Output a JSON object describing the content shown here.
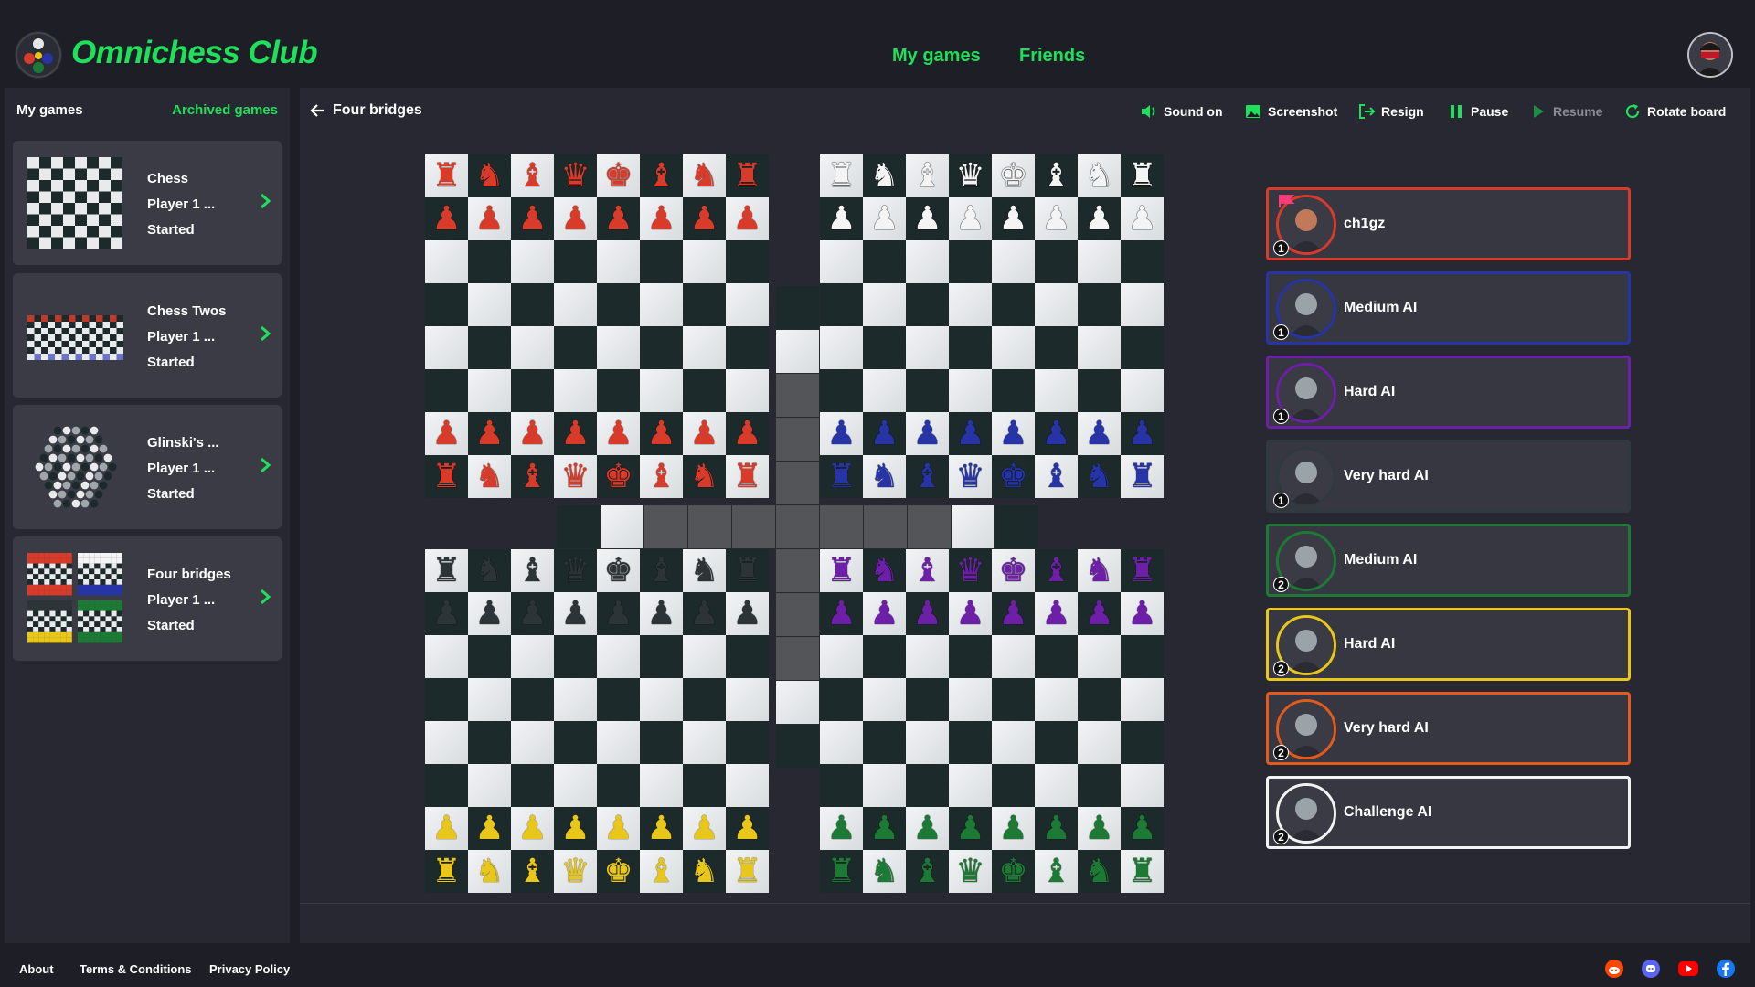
{
  "header": {
    "logo_text": "Omnichess Club",
    "nav": [
      "My games",
      "Friends"
    ]
  },
  "sidebar": {
    "title": "My games",
    "archived_link": "Archived games",
    "games": [
      {
        "name": "Chess",
        "player": "Player 1 ...",
        "status": "Started"
      },
      {
        "name": "Chess Twos",
        "player": "Player 1 ...",
        "status": "Started"
      },
      {
        "name": "Glinski's ...",
        "player": "Player 1 ...",
        "status": "Started"
      },
      {
        "name": "Four bridges",
        "player": "Player 1 ...",
        "status": "Started"
      }
    ]
  },
  "toolbar": {
    "game_title": "Four bridges",
    "sound": "Sound on",
    "screenshot": "Screenshot",
    "resign": "Resign",
    "pause": "Pause",
    "resume": "Resume",
    "rotate": "Rotate board"
  },
  "colors": {
    "accent": "#1ee05a",
    "red": "#d93b2b",
    "blue": "#2634a8",
    "purple": "#6d1fa8",
    "yellow": "#e8c71a",
    "green": "#1d7a35",
    "black": "#2d3437",
    "white": "#f4f4f4"
  },
  "board": {
    "armies": [
      {
        "color": "red",
        "back_rank": "rnbqkbnr"
      },
      {
        "color": "white",
        "back_rank": "rnbqkbnr"
      },
      {
        "color": "red",
        "back_rank": "rnbqkbnr"
      },
      {
        "color": "blue",
        "back_rank": "rnbqkbnr"
      },
      {
        "color": "black",
        "back_rank": "rnbqkbnr"
      },
      {
        "color": "purple",
        "back_rank": "rnbqkbnr"
      },
      {
        "color": "yellow",
        "back_rank": "rnbqkbnr"
      },
      {
        "color": "green",
        "back_rank": "rnbqkbnr"
      }
    ]
  },
  "players": [
    {
      "name": "ch1gz",
      "team": "1",
      "border": "#d93b2b",
      "flag": true
    },
    {
      "name": "Medium AI",
      "team": "1",
      "border": "#2634a8"
    },
    {
      "name": "Hard AI",
      "team": "1",
      "border": "#6d1fa8"
    },
    {
      "name": "Very hard AI",
      "team": "1",
      "border": "#2f3a3e"
    },
    {
      "name": "Medium AI",
      "team": "2",
      "border": "#1d7a35"
    },
    {
      "name": "Hard AI",
      "team": "2",
      "border": "#e8c71a"
    },
    {
      "name": "Very hard AI",
      "team": "2",
      "border": "#e35a1c"
    },
    {
      "name": "Challenge AI",
      "team": "2",
      "border": "#f2f2f2"
    }
  ],
  "footer": {
    "links": [
      "About",
      "Terms & Conditions",
      "Privacy Policy"
    ],
    "social": [
      "reddit-icon",
      "discord-icon",
      "youtube-icon",
      "facebook-icon"
    ]
  }
}
